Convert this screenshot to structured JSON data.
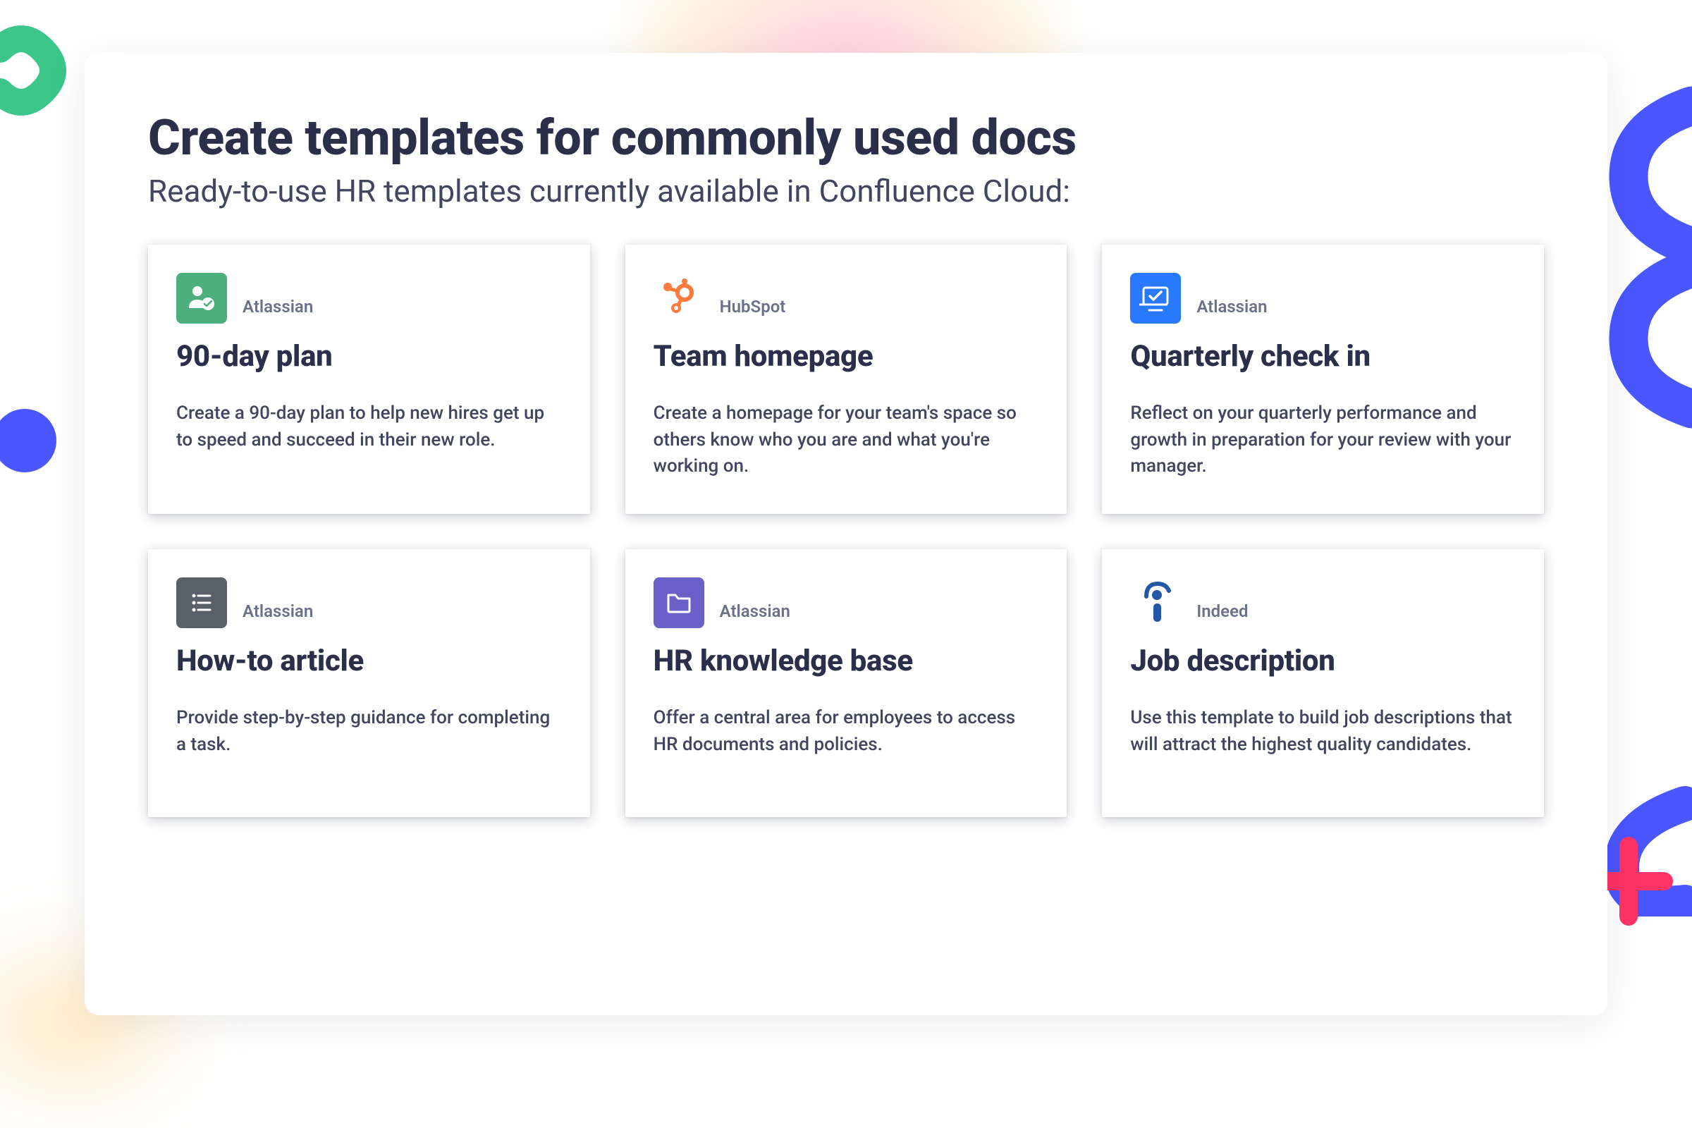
{
  "heading": "Create templates for commonly used docs",
  "subheading": "Ready-to-use HR templates currently available in Confluence Cloud:",
  "cards": [
    {
      "vendor": "Atlassian",
      "title": "90-day plan",
      "description": "Create a 90-day plan to help new hires get up to speed and succeed in their new role.",
      "icon": "person-check",
      "icon_bg": "#4caf7d"
    },
    {
      "vendor": "HubSpot",
      "title": "Team homepage",
      "description": "Create a homepage for your team's space so others know who you are and what you're working on.",
      "icon": "hubspot",
      "icon_bg": "transparent"
    },
    {
      "vendor": "Atlassian",
      "title": "Quarterly check in",
      "description": "Reflect on your quarterly performance and growth in preparation for your review with your manager.",
      "icon": "monitor-check",
      "icon_bg": "#2979ff"
    },
    {
      "vendor": "Atlassian",
      "title": "How-to article",
      "description": "Provide step-by-step guidance for completing a task.",
      "icon": "list",
      "icon_bg": "#58606a"
    },
    {
      "vendor": "Atlassian",
      "title": "HR knowledge base",
      "description": "Offer a central area for employees to access HR documents and policies.",
      "icon": "folder",
      "icon_bg": "#6b5fc8"
    },
    {
      "vendor": "Indeed",
      "title": "Job description",
      "description": "Use this template to build job descriptions that will attract the highest quality candidates.",
      "icon": "indeed",
      "icon_bg": "transparent"
    }
  ]
}
